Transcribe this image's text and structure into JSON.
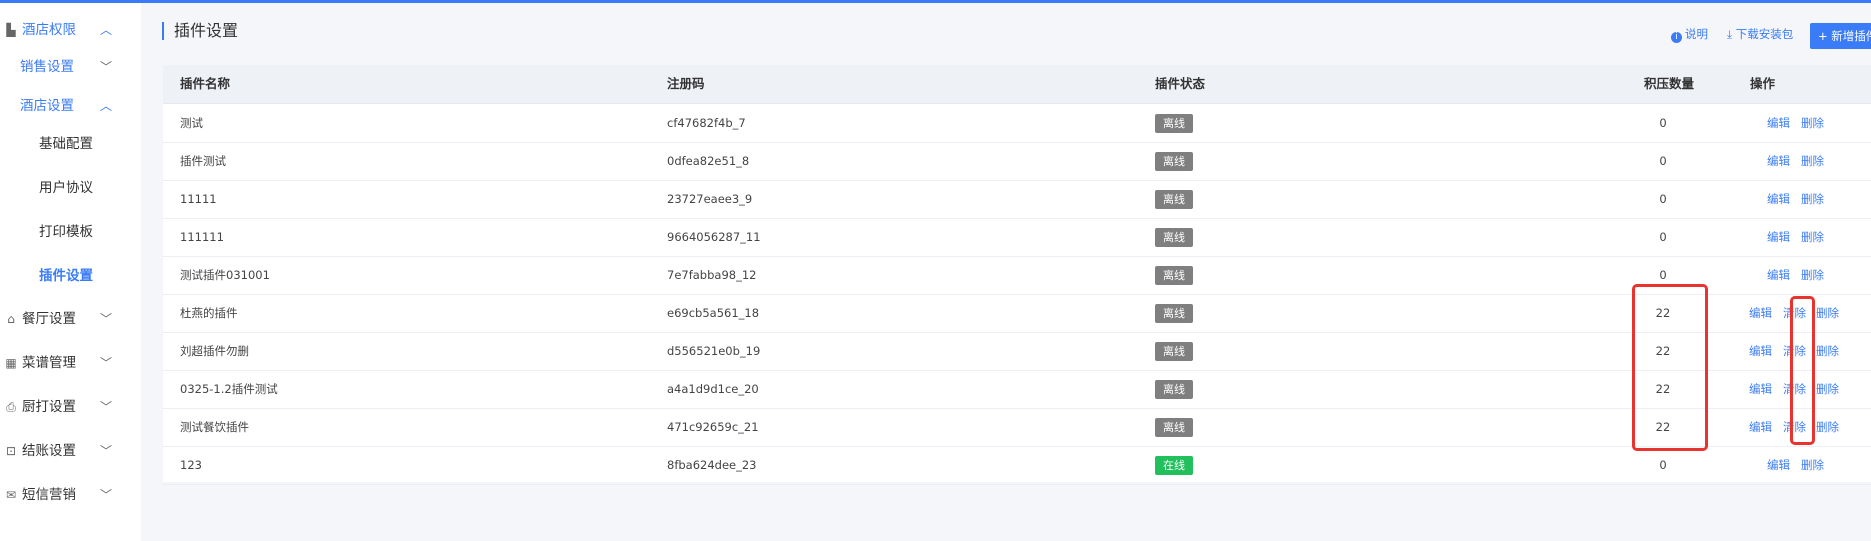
{
  "sidebar": {
    "items": [
      {
        "label": "酒店权限",
        "icon": "hotel-icon"
      },
      {
        "label": "销售设置"
      },
      {
        "label": "酒店设置"
      },
      {
        "label": "基础配置"
      },
      {
        "label": "用户协议"
      },
      {
        "label": "打印模板"
      },
      {
        "label": "插件设置"
      },
      {
        "label": "餐厅设置",
        "icon": "restaurant-icon"
      },
      {
        "label": "菜谱管理",
        "icon": "grid-icon"
      },
      {
        "label": "厨打设置",
        "icon": "printer-icon"
      },
      {
        "label": "结账设置",
        "icon": "checkout-icon"
      },
      {
        "label": "短信营销",
        "icon": "mail-icon"
      }
    ]
  },
  "header": {
    "title": "插件设置",
    "help_label": "说明",
    "download_label": "下载安装包",
    "add_label": "+ 新增插件"
  },
  "table": {
    "columns": [
      "插件名称",
      "注册码",
      "插件状态",
      "积压数量",
      "操作"
    ],
    "rows": [
      {
        "name": "测试",
        "code": "cf47682f4b_7",
        "status": "离线",
        "backlog": "0",
        "actions": [
          "编辑",
          "删除"
        ]
      },
      {
        "name": "插件测试",
        "code": "0dfea82e51_8",
        "status": "离线",
        "backlog": "0",
        "actions": [
          "编辑",
          "删除"
        ]
      },
      {
        "name": "11111",
        "code": "23727eaee3_9",
        "status": "离线",
        "backlog": "0",
        "actions": [
          "编辑",
          "删除"
        ]
      },
      {
        "name": "111111",
        "code": "9664056287_11",
        "status": "离线",
        "backlog": "0",
        "actions": [
          "编辑",
          "删除"
        ]
      },
      {
        "name": "测试插件031001",
        "code": "7e7fabba98_12",
        "status": "离线",
        "backlog": "0",
        "actions": [
          "编辑",
          "删除"
        ]
      },
      {
        "name": "杜燕的插件",
        "code": "e69cb5a561_18",
        "status": "离线",
        "backlog": "22",
        "actions": [
          "编辑",
          "清除",
          "删除"
        ]
      },
      {
        "name": "刘超插件勿删",
        "code": "d556521e0b_19",
        "status": "离线",
        "backlog": "22",
        "actions": [
          "编辑",
          "清除",
          "删除"
        ]
      },
      {
        "name": "0325-1.2插件测试",
        "code": "a4a1d9d1ce_20",
        "status": "离线",
        "backlog": "22",
        "actions": [
          "编辑",
          "清除",
          "删除"
        ]
      },
      {
        "name": "测试餐饮插件",
        "code": "471c92659c_21",
        "status": "离线",
        "backlog": "22",
        "actions": [
          "编辑",
          "清除",
          "删除"
        ]
      },
      {
        "name": "123",
        "code": "8fba624dee_23",
        "status": "在线",
        "backlog": "0",
        "actions": [
          "编辑",
          "删除"
        ]
      }
    ]
  },
  "colors": {
    "accent": "#3a7cf7",
    "offline": "#7f7f7f",
    "online": "#21c05c",
    "highlight": "#e8332e"
  }
}
